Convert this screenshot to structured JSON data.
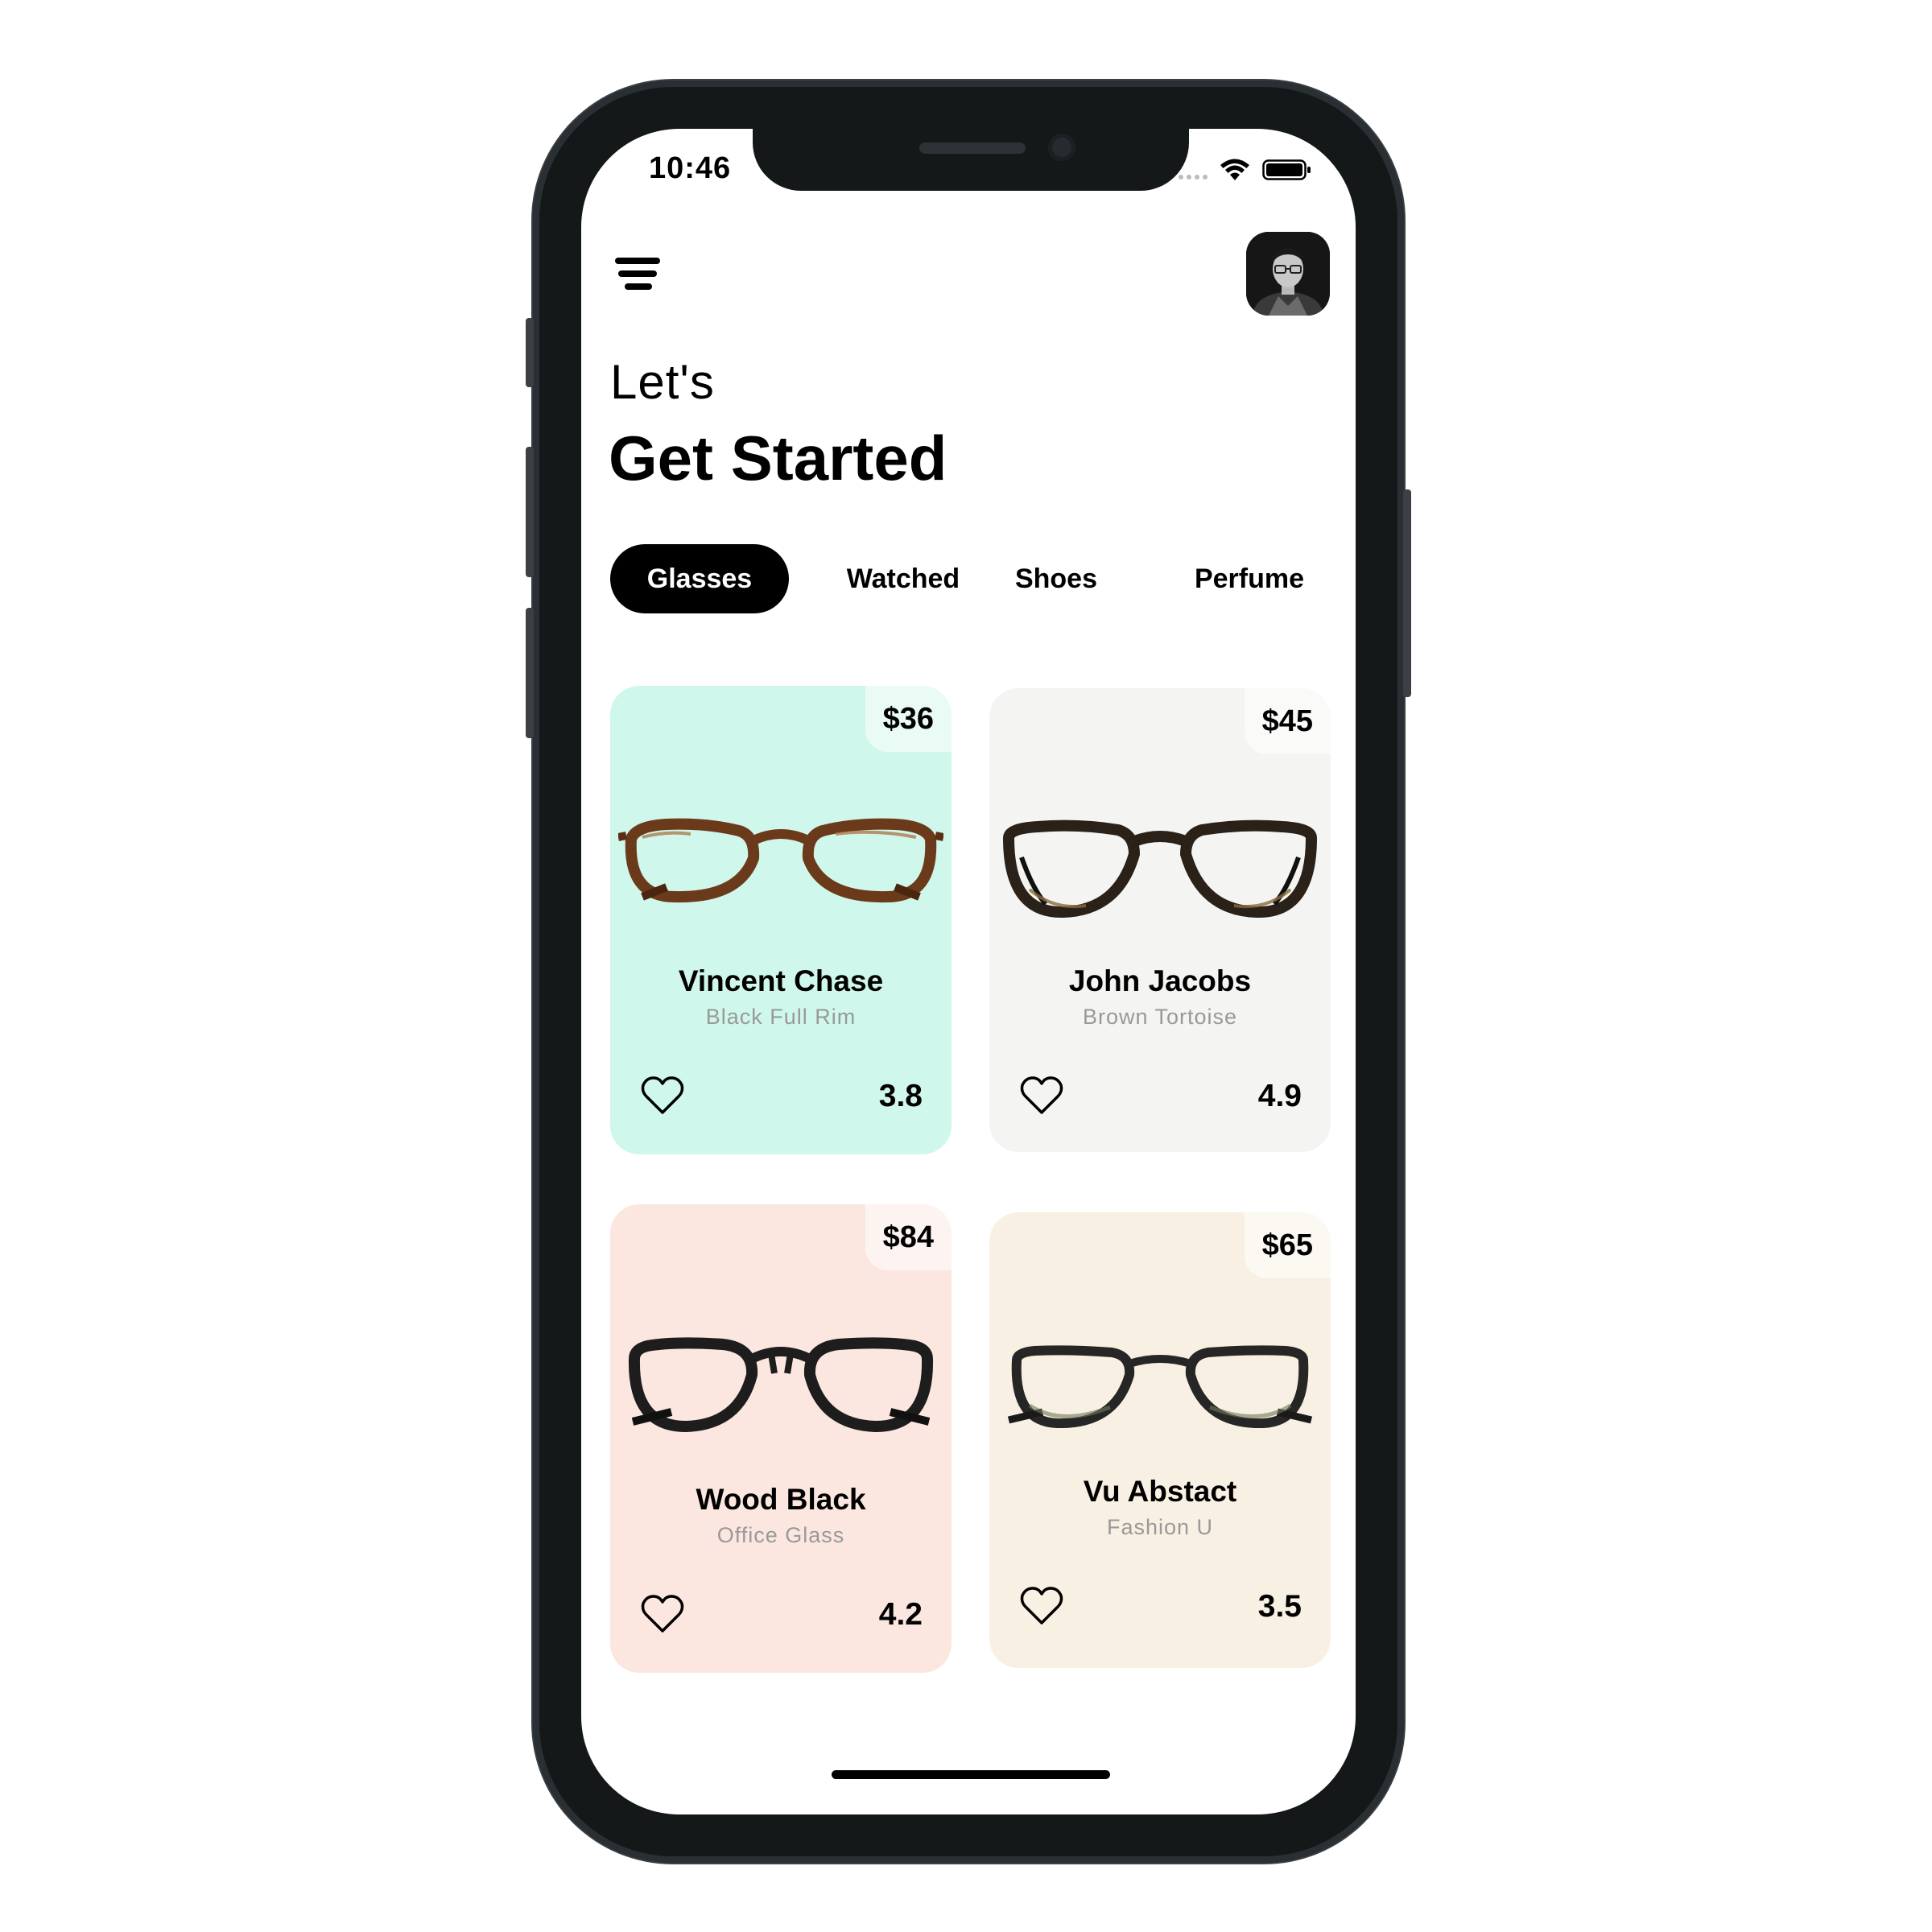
{
  "status_bar": {
    "time": "10:46"
  },
  "header": {
    "menu_icon": "menu-icon",
    "avatar_icon": "user-avatar",
    "greeting_small": "Let's",
    "greeting_big": "Get Started"
  },
  "tabs": [
    {
      "label": "Glasses",
      "active": true
    },
    {
      "label": "Watched",
      "active": false
    },
    {
      "label": "Shoes",
      "active": false
    },
    {
      "label": "Perfume",
      "active": false
    }
  ],
  "products": [
    {
      "name": "Vincent Chase",
      "subtitle": "Black Full Rim",
      "price": "$36",
      "rating": "3.8",
      "bg_color": "#d0f7eb",
      "frame_color": "#6b3a1a"
    },
    {
      "name": "John Jacobs",
      "subtitle": "Brown Tortoise",
      "price": "$45",
      "rating": "4.9",
      "bg_color": "#f4f4f2",
      "frame_color": "#2a2118"
    },
    {
      "name": "Wood Black",
      "subtitle": "Office Glass",
      "price": "$84",
      "rating": "4.2",
      "bg_color": "#fbe7df",
      "frame_color": "#1d1d1d"
    },
    {
      "name": "Vu Abstact",
      "subtitle": "Fashion U",
      "price": "$65",
      "rating": "3.5",
      "bg_color": "#f8f0e2",
      "frame_color": "#262626"
    }
  ],
  "colors": {
    "tab_active_bg": "#000000",
    "phone_frame": "#151819"
  }
}
